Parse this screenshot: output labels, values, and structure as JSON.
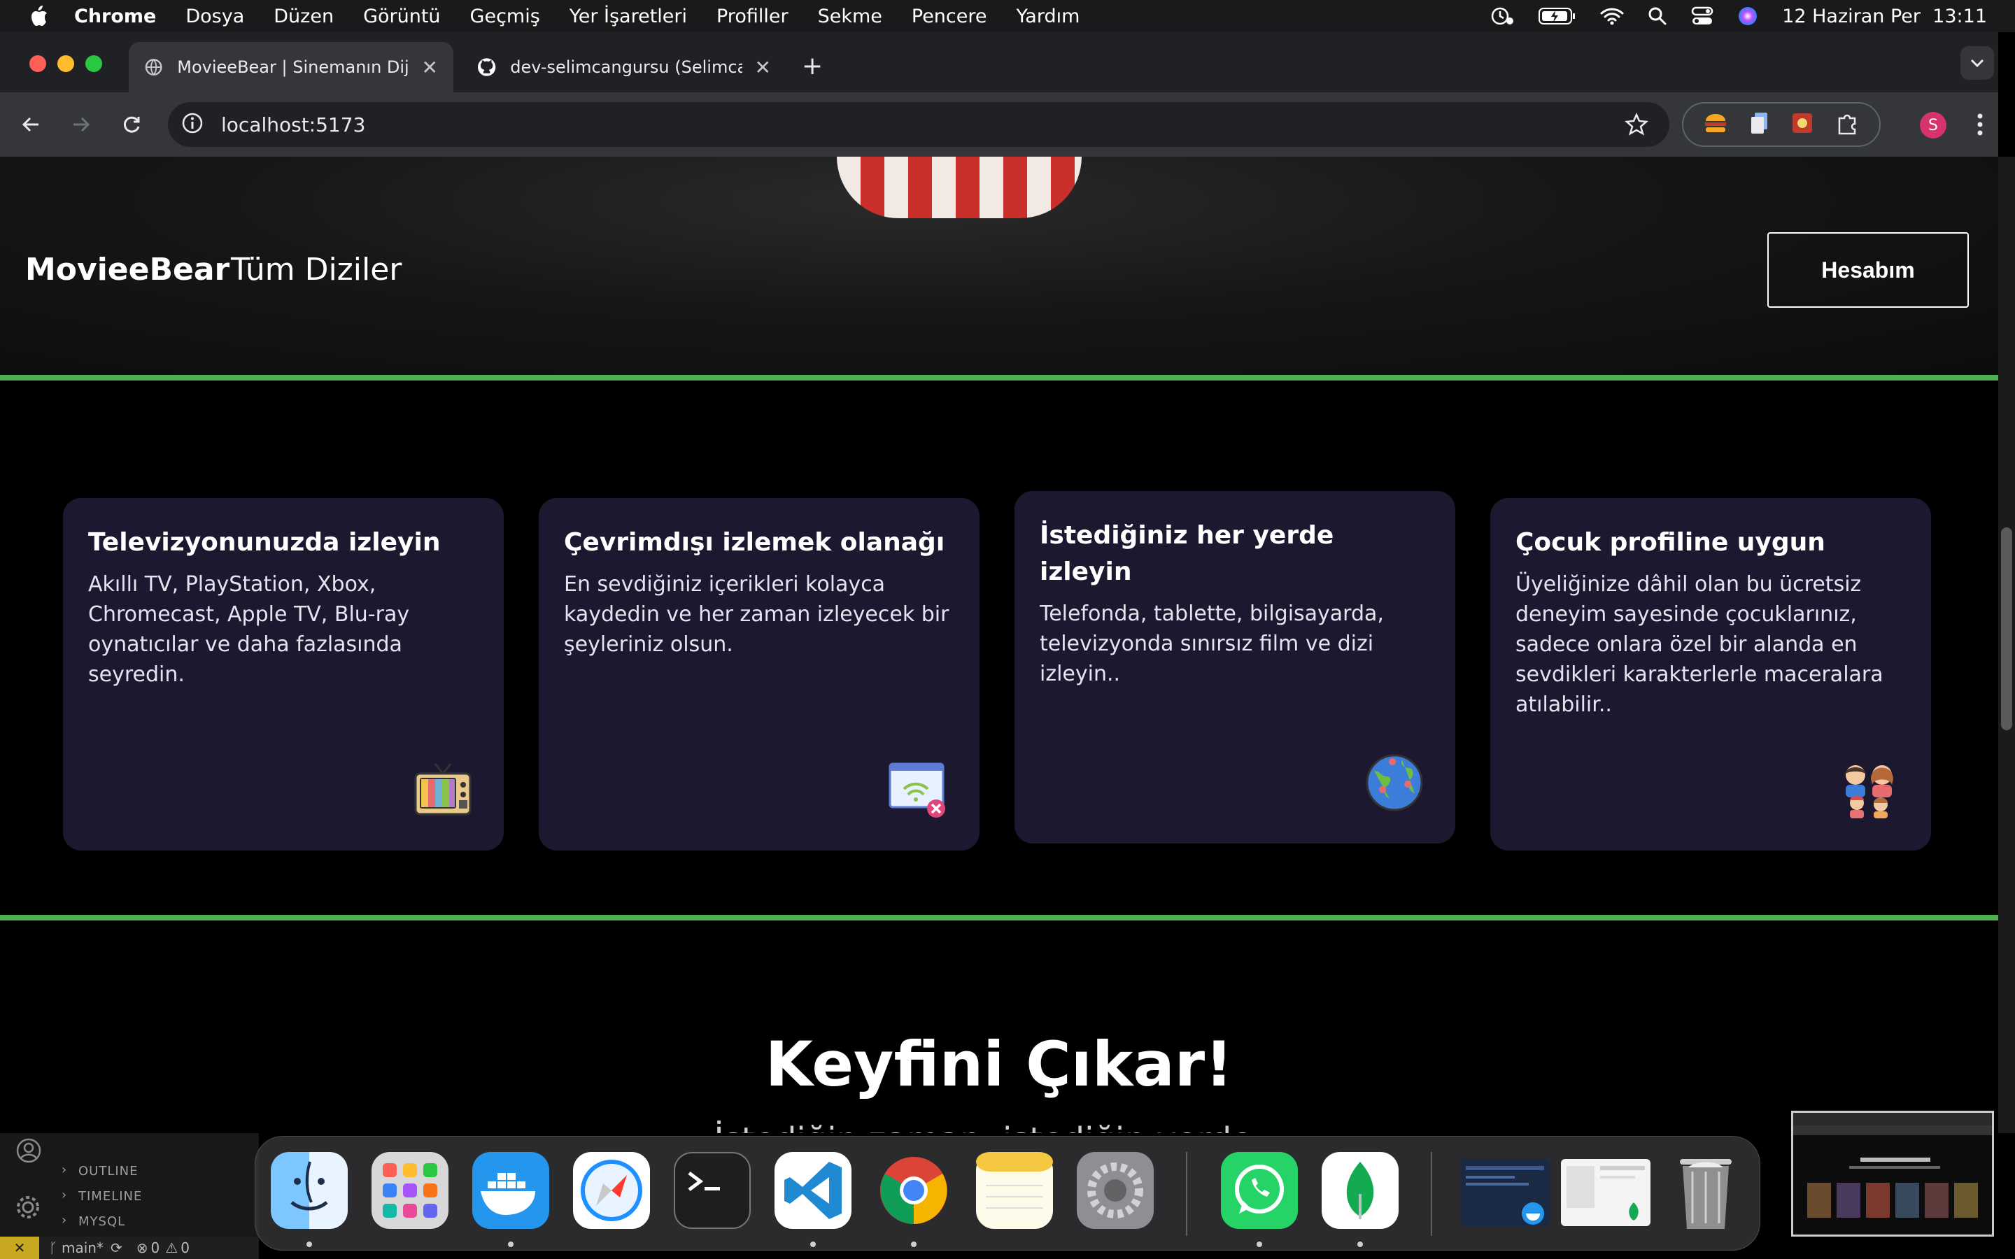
{
  "menubar": {
    "items": [
      "Chrome",
      "Dosya",
      "Düzen",
      "Görüntü",
      "Geçmiş",
      "Yer İşaretleri",
      "Profiller",
      "Sekme",
      "Pencere",
      "Yardım"
    ],
    "clock": "12 Haziran Per  13:11"
  },
  "browser": {
    "tabs": [
      {
        "title": "MovieeBear | Sinemanın Dijital"
      },
      {
        "title": "dev-selimcangursu (Selimcan"
      }
    ],
    "url": "localhost:5173",
    "profile_initial": "S"
  },
  "page": {
    "brand": "MovieeBear",
    "nav_all_series": "Tüm Diziler",
    "account_button": "Hesabım",
    "features": [
      {
        "title": "Televizyonunuzda izleyin",
        "text": "Akıllı TV, PlayStation, Xbox, Chromecast, Apple TV, Blu-ray oynatıcılar ve daha fazlasında seyredin.",
        "icon": "tv-icon"
      },
      {
        "title": "Çevrimdışı izlemek olanağı",
        "text": "En sevdiğiniz içerikleri kolayca kaydedin ve her zaman izleyecek bir şeyleriniz olsun.",
        "icon": "offline-wifi-icon"
      },
      {
        "title": "İstediğiniz her yerde izleyin",
        "text": "Telefonda, tablette, bilgisayarda, televizyonda sınırsız film ve dizi izleyin..",
        "icon": "globe-icon"
      },
      {
        "title": "Çocuk profiline uygun",
        "text": "Üyeliğinize dâhil olan bu ücretsiz deneyim sayesinde çocuklarınız, sadece onlara özel bir alanda en sevdikleri karakterlerle maceralara atılabilir..",
        "icon": "family-icon"
      }
    ],
    "cta_title": "Keyfini Çıkar!",
    "cta_subtitle": "İstediğin zaman, istediğin yerde..."
  },
  "vscode": {
    "sections": [
      "OUTLINE",
      "TIMELINE",
      "MYSQL"
    ],
    "branch": "main*",
    "problems": "0",
    "warnings": "0"
  },
  "colors": {
    "accent_green": "#4caf50",
    "card_bg": "#1c1830"
  }
}
